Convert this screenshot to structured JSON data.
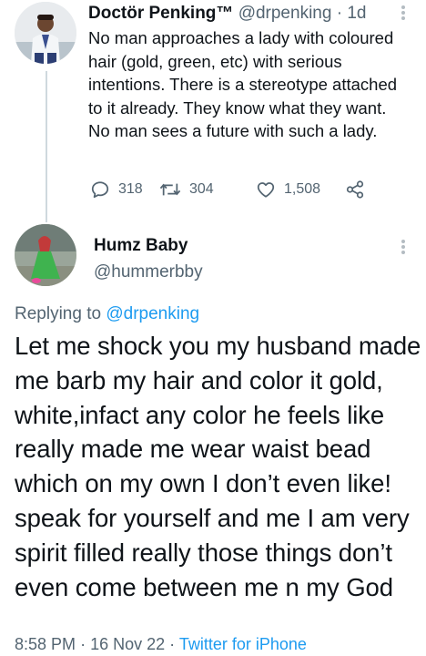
{
  "tweet_original": {
    "author_name": "Doctör Penking™",
    "handle": "@drpenking",
    "separator": "·",
    "time": "1d",
    "text": "No man approaches a lady with coloured hair (gold, green, etc) with serious intentions. There is a stereotype attached to it already. They know what they want. No man sees a future with such a lady.",
    "replies": "318",
    "retweets": "304",
    "likes": "1,508",
    "icons": [
      "reply-icon",
      "retweet-icon",
      "like-icon",
      "share-icon",
      "more-icon"
    ]
  },
  "tweet_reply": {
    "author_name": "Humz Baby",
    "handle": "@hummerbby",
    "replying_prefix": "Replying to",
    "replying_to": "@drpenking",
    "text": "Let me shock you my husband made me barb my hair and color it gold, white,infact any color he feels like really made me wear waist bead which on my own I don’t even like! speak for yourself and me I am very spirit filled really those things don’t even come between me n my God",
    "time": "8:58 PM",
    "date": "16 Nov 22",
    "separator": "·",
    "source": "Twitter for iPhone"
  },
  "colors": {
    "text_primary": "#0f1419",
    "text_secondary": "#536471",
    "link": "#1d9bf0",
    "thread_line": "#cfd9de"
  }
}
